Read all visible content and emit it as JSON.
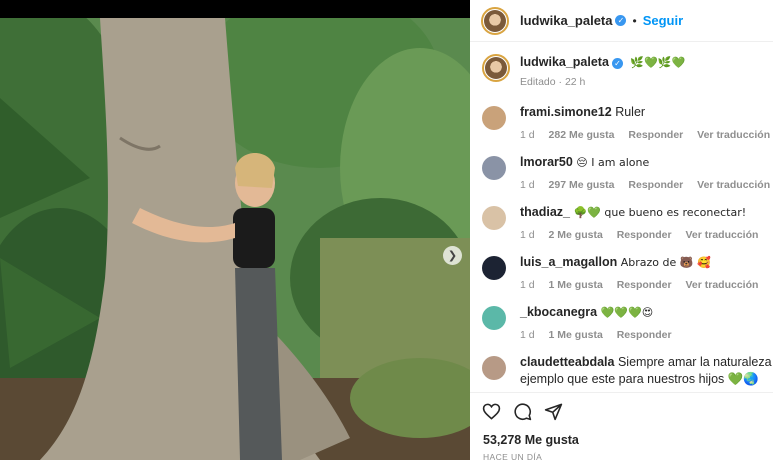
{
  "post": {
    "author": "ludwika_paleta",
    "follow_label": "Seguir",
    "separator": "•",
    "caption": "🌿💚🌿💚",
    "edited_label": "Editado · 22 h",
    "likes": "53,278 Me gusta",
    "timestamp": "HACE UN DÍA"
  },
  "comments": [
    {
      "user": "frami.simone12",
      "text": "Ruler",
      "age": "1 d",
      "likes": "282 Me gusta",
      "reply": "Responder",
      "translate": "Ver traducción",
      "avatar_color": "#c9a27a"
    },
    {
      "user": "lmorar50",
      "text": "😔 I am alone",
      "age": "1 d",
      "likes": "297 Me gusta",
      "reply": "Responder",
      "translate": "Ver traducción",
      "avatar_color": "#8a93a6"
    },
    {
      "user": "thadiaz_",
      "text": "🌳💚 que bueno es reconectar!",
      "age": "1 d",
      "likes": "2 Me gusta",
      "reply": "Responder",
      "translate": "Ver traducción",
      "avatar_color": "#d9c2a6"
    },
    {
      "user": "luis_a_magallon",
      "text": "Abrazo de 🐻 🥰",
      "age": "1 d",
      "likes": "1 Me gusta",
      "reply": "Responder",
      "translate": "Ver traducción",
      "avatar_color": "#1c2333"
    },
    {
      "user": "_kbocanegra",
      "text": "💚💚💚😍",
      "age": "1 d",
      "likes": "1 Me gusta",
      "reply": "Responder",
      "translate": "",
      "avatar_color": "#5bb8a8"
    },
    {
      "user": "claudetteabdala",
      "text": "Siempre amar la naturaleza , no ha",
      "text2": "ejemplo que este para nuestros hijos 💚🌏",
      "age": "",
      "likes": "",
      "reply": "",
      "translate": "",
      "avatar_color": "#b79a86"
    }
  ],
  "icons": [
    "heart-icon",
    "comment-icon",
    "share-icon",
    "chevron-right-icon",
    "verified-icon"
  ],
  "colors": {
    "accent": "#0095f6",
    "verified": "#3897f0",
    "muted": "#8e8e8e"
  }
}
